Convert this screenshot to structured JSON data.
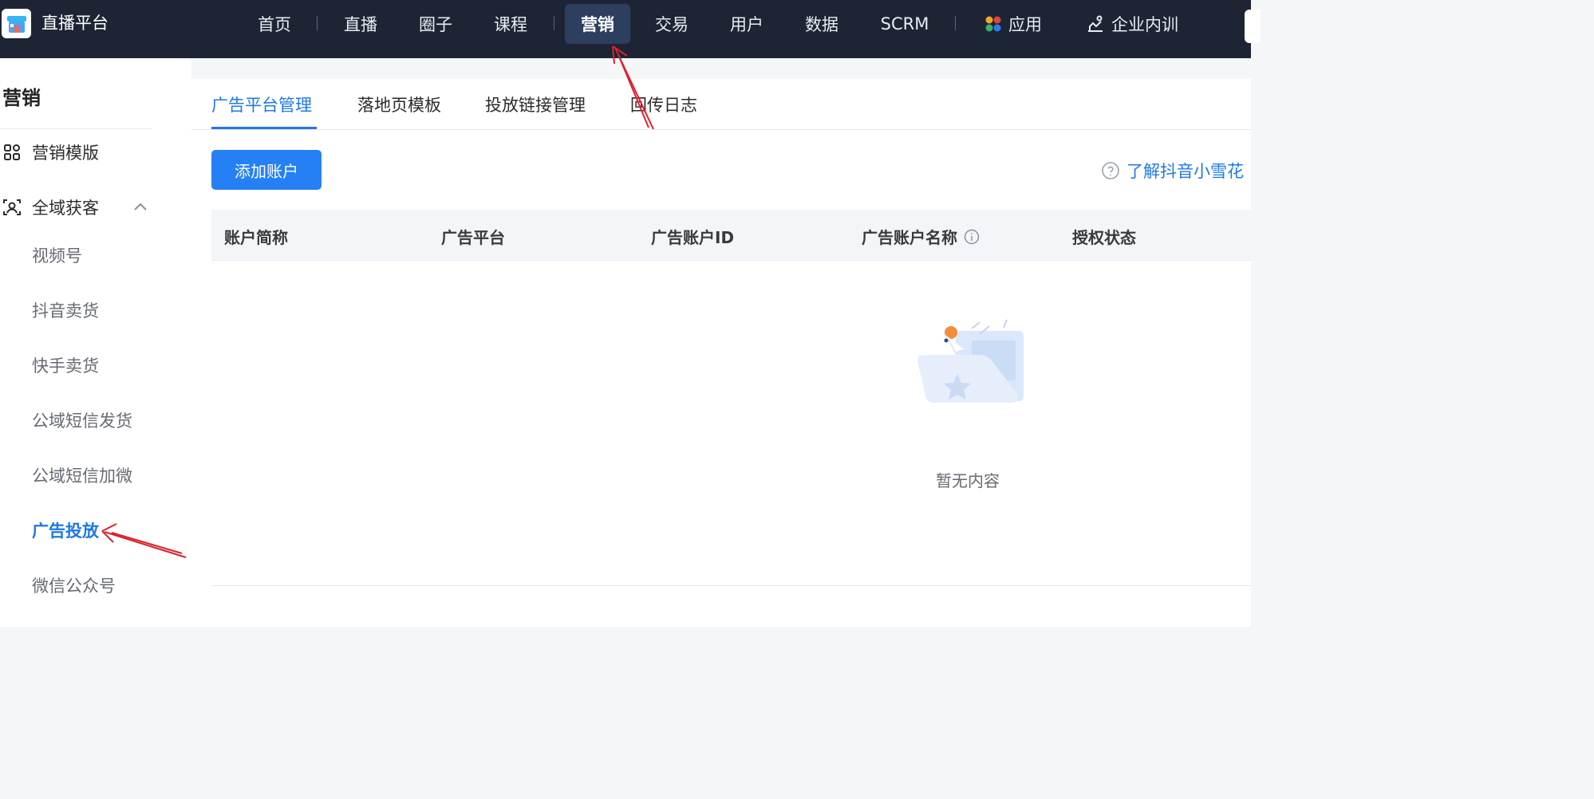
{
  "app": {
    "title": "直播平台"
  },
  "nav": {
    "items": [
      {
        "label": "首页"
      },
      {
        "label": "直播"
      },
      {
        "label": "圈子"
      },
      {
        "label": "课程"
      },
      {
        "label": "营销"
      },
      {
        "label": "交易"
      },
      {
        "label": "用户"
      },
      {
        "label": "数据"
      },
      {
        "label": "SCRM"
      },
      {
        "label": "应用"
      },
      {
        "label": "企业内训"
      }
    ],
    "active": "营销"
  },
  "sidebar": {
    "title": "营销",
    "groups": [
      {
        "label": "营销模版",
        "icon": "grid-icon"
      },
      {
        "label": "全域获客",
        "icon": "scan-user-icon",
        "expanded": true
      }
    ],
    "sub_items": [
      {
        "label": "视频号"
      },
      {
        "label": "抖音卖货"
      },
      {
        "label": "快手卖货"
      },
      {
        "label": "公域短信发货"
      },
      {
        "label": "公域短信加微"
      },
      {
        "label": "广告投放"
      },
      {
        "label": "微信公众号"
      }
    ],
    "active_sub": "广告投放"
  },
  "tabs": [
    {
      "label": "广告平台管理"
    },
    {
      "label": "落地页模板"
    },
    {
      "label": "投放链接管理"
    },
    {
      "label": "回传日志"
    }
  ],
  "active_tab": "广告平台管理",
  "toolbar": {
    "add_button": "添加账户",
    "help_link": "了解抖音小雪花"
  },
  "table": {
    "columns": [
      {
        "label": "账户简称"
      },
      {
        "label": "广告平台"
      },
      {
        "label": "广告账户ID"
      },
      {
        "label": "广告账户名称",
        "info": true
      },
      {
        "label": "授权状态"
      }
    ],
    "rows": [],
    "empty_text": "暂无内容"
  },
  "colors": {
    "topbar": "#1d2535",
    "accent": "#1e78e6",
    "primary_button": "#2680f5",
    "annotation_arrow": "#d9232e"
  }
}
